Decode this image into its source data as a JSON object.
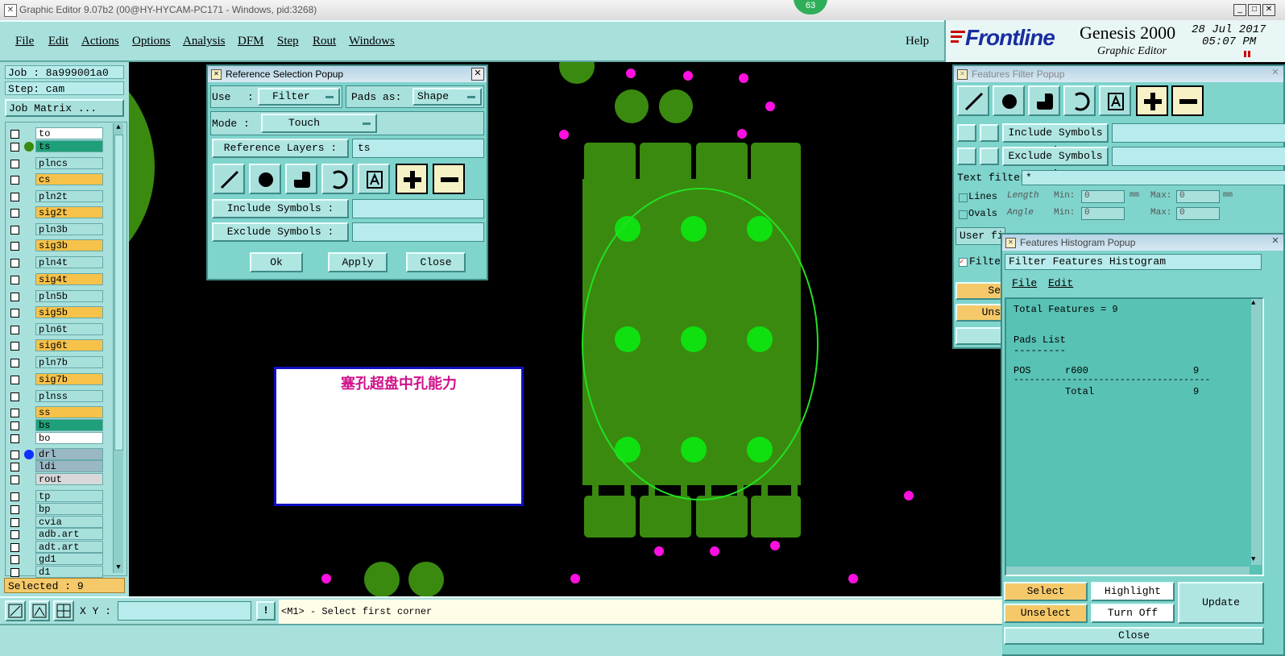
{
  "window": {
    "title": "Graphic Editor 9.07b2 (00@HY-HYCAM-PC171 - Windows, pid:3268)",
    "badge": "63"
  },
  "menu": {
    "file": "File",
    "edit": "Edit",
    "actions": "Actions",
    "options": "Options",
    "analysis": "Analysis",
    "dfm": "DFM",
    "step": "Step",
    "rout": "Rout",
    "windows": "Windows",
    "help": "Help"
  },
  "brand": {
    "logo": "Frontline",
    "product": "Genesis 2000",
    "subtitle": "Graphic Editor",
    "date": "28 Jul 2017",
    "time": "05:07 PM"
  },
  "left": {
    "job": "Job : 8a999001a0",
    "step": "Step: cam",
    "job_matrix": "Job Matrix ...",
    "selected": "Selected : 9"
  },
  "layers": [
    {
      "name": "to",
      "color": "#ffffff",
      "dot": ""
    },
    {
      "name": "ts",
      "color": "#1fa07a",
      "dot": "#3a8a10"
    },
    {
      "name": "plncs",
      "color": "#a8e0dc",
      "dot": ""
    },
    {
      "name": "cs",
      "color": "#f7c24a",
      "dot": ""
    },
    {
      "name": "pln2t",
      "color": "#a8e0dc",
      "dot": ""
    },
    {
      "name": "sig2t",
      "color": "#f7c24a",
      "dot": ""
    },
    {
      "name": "pln3b",
      "color": "#a8e0dc",
      "dot": ""
    },
    {
      "name": "sig3b",
      "color": "#f7c24a",
      "dot": ""
    },
    {
      "name": "pln4t",
      "color": "#a8e0dc",
      "dot": ""
    },
    {
      "name": "sig4t",
      "color": "#f7c24a",
      "dot": ""
    },
    {
      "name": "pln5b",
      "color": "#a8e0dc",
      "dot": ""
    },
    {
      "name": "sig5b",
      "color": "#f7c24a",
      "dot": ""
    },
    {
      "name": "pln6t",
      "color": "#a8e0dc",
      "dot": ""
    },
    {
      "name": "sig6t",
      "color": "#f7c24a",
      "dot": ""
    },
    {
      "name": "pln7b",
      "color": "#a8e0dc",
      "dot": ""
    },
    {
      "name": "sig7b",
      "color": "#f7c24a",
      "dot": ""
    },
    {
      "name": "plnss",
      "color": "#a8e0dc",
      "dot": ""
    },
    {
      "name": "ss",
      "color": "#f7c24a",
      "dot": ""
    },
    {
      "name": "bs",
      "color": "#1fa07a",
      "dot": ""
    },
    {
      "name": "bo",
      "color": "#ffffff",
      "dot": ""
    },
    {
      "name": "drl",
      "color": "#9ab8c4",
      "dot": "#1030ff"
    },
    {
      "name": "ldi",
      "color": "#9ab8c4",
      "dot": ""
    },
    {
      "name": "rout",
      "color": "#d8d8d8",
      "dot": ""
    },
    {
      "name": "tp",
      "color": "#a8e0dc",
      "dot": ""
    },
    {
      "name": "bp",
      "color": "#a8e0dc",
      "dot": ""
    },
    {
      "name": "cvia",
      "color": "#a8e0dc",
      "dot": ""
    },
    {
      "name": "adb.art",
      "color": "#a8e0dc",
      "dot": ""
    },
    {
      "name": "adt.art",
      "color": "#a8e0dc",
      "dot": ""
    },
    {
      "name": "gd1",
      "color": "#a8e0dc",
      "dot": ""
    },
    {
      "name": "d1",
      "color": "#a8e0dc",
      "dot": ""
    }
  ],
  "canvas": {
    "note": "塞孔超盘中孔能力"
  },
  "ref_popup": {
    "title": "Reference Selection Popup",
    "use_label": "Use",
    "use_sep": ":",
    "use_value": "Filter",
    "pads_label": "Pads as:",
    "pads_value": "Shape",
    "mode_label": "Mode :",
    "mode_value": "Touch",
    "ref_layers_label": "Reference Layers :",
    "ref_layers_value": "ts",
    "include_label": "Include Symbols :",
    "exclude_label": "Exclude Symbols :",
    "ok": "Ok",
    "apply": "Apply",
    "close": "Close"
  },
  "filter_popup": {
    "title": "Features Filter Popup",
    "include_label": "Include Symbols :",
    "exclude_label": "Exclude Symbols :",
    "text_filter_label": "Text filter",
    "text_filter_value": "*",
    "lines": "Lines",
    "ovals": "Ovals",
    "length": "Length",
    "angle": "Angle",
    "min": "Min:",
    "max": "Max:",
    "zero": "0",
    "mm": "mm",
    "user_filter": "User fi",
    "filter_cb": "Filte",
    "select_partial": "Se",
    "unselect_partial": "Uns"
  },
  "hist_popup": {
    "title": "Features Histogram Popup",
    "header": "Filter Features Histogram",
    "file": "File",
    "edit": "Edit",
    "total_features": "Total Features = 9",
    "pads_list": "Pads List",
    "underline": "---------",
    "row_pos": "POS",
    "row_sym": "r600",
    "row_count": "9",
    "dash_line": "-------------------------------------",
    "total_label": "Total",
    "total_count": "9",
    "select": "Select",
    "highlight": "Highlight",
    "update": "Update",
    "unselect": "Unselect",
    "turn_off": "Turn Off",
    "close": "Close"
  },
  "bottom": {
    "xy_label": "X Y :",
    "prompt": "<M1> - Select first corner"
  }
}
